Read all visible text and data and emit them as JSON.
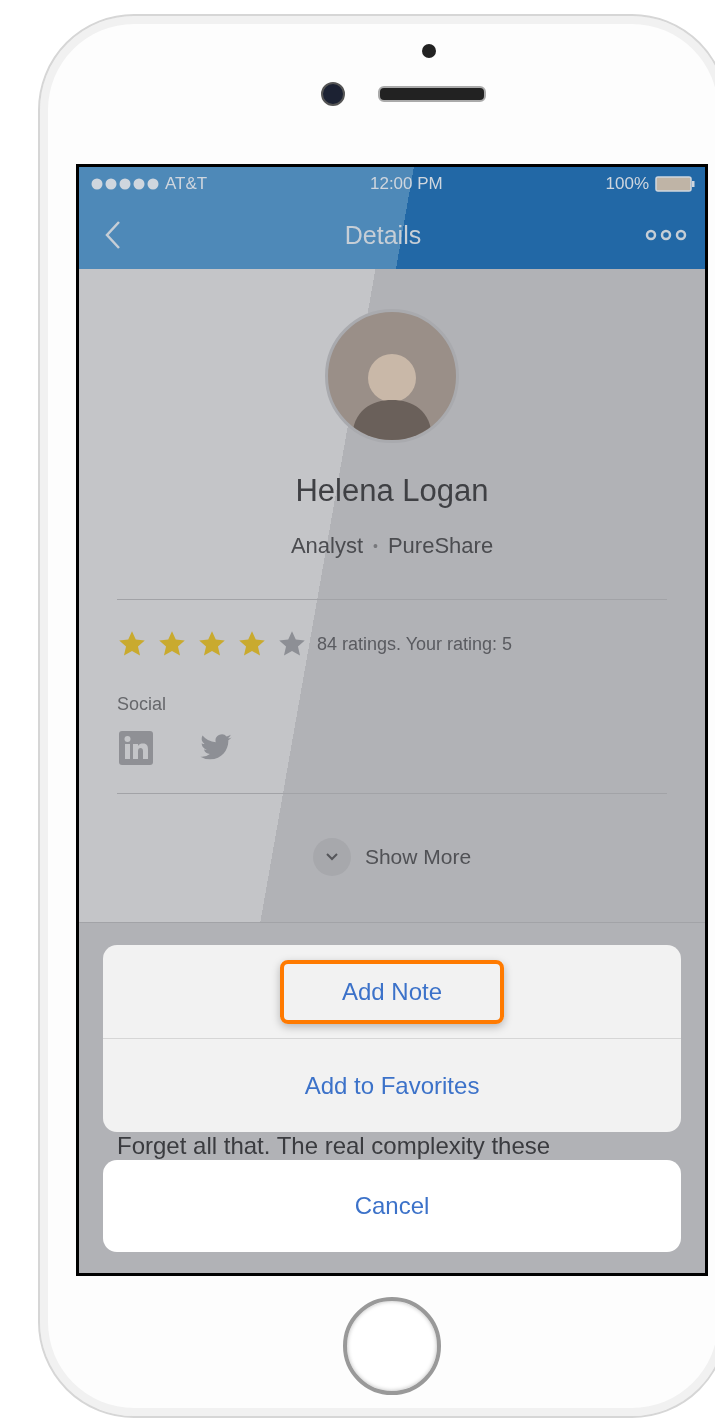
{
  "status_bar": {
    "carrier": "AT&T",
    "time": "12:00 PM",
    "battery": "100%"
  },
  "nav": {
    "title": "Details"
  },
  "profile": {
    "name": "Helena Logan",
    "role": "Analyst",
    "separator": "•",
    "company": "PureShare"
  },
  "rating": {
    "stars": 4,
    "text": "84 ratings. Your rating: 5"
  },
  "social": {
    "label": "Social"
  },
  "show_more": {
    "label": "Show More"
  },
  "body_text": "Forget all that. The real complexity these",
  "action_sheet": {
    "actions": [
      {
        "label": "Add Note",
        "highlighted": true
      },
      {
        "label": "Add to Favorites",
        "highlighted": false
      }
    ],
    "cancel": "Cancel"
  }
}
